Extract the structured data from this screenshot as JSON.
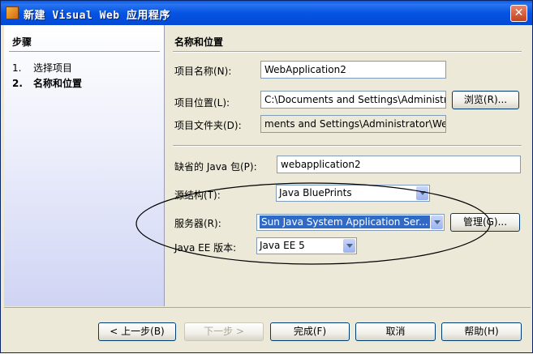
{
  "window": {
    "title": "新建 Visual Web 应用程序"
  },
  "steps": {
    "title": "步骤",
    "items": [
      {
        "num": "1.",
        "label": "选择项目"
      },
      {
        "num": "2.",
        "label": "名称和位置"
      }
    ]
  },
  "form": {
    "section_title": "名称和位置",
    "project_name": {
      "label": "项目名称(N):",
      "value": "WebApplication2"
    },
    "project_location": {
      "label": "项目位置(L):",
      "value": "C:\\Documents and Settings\\Administr",
      "browse": "浏览(R)..."
    },
    "project_folder": {
      "label": "项目文件夹(D):",
      "value": "ments and Settings\\Administrator\\Web"
    },
    "default_package": {
      "label": "缺省的 Java 包(P):",
      "value": "webapplication2"
    },
    "source_structure": {
      "label": "源结构(T):",
      "value": "Java BluePrints"
    },
    "server": {
      "label": "服务器(R):",
      "value": "Sun Java System Application Ser...",
      "manage": "管理(G)..."
    },
    "javaee_version": {
      "label": "Java EE 版本:",
      "value": "Java EE 5"
    }
  },
  "buttons": {
    "back": "< 上一步(B)",
    "next": "下一步 >",
    "finish": "完成(F)",
    "cancel": "取消",
    "help": "帮助(H)"
  }
}
